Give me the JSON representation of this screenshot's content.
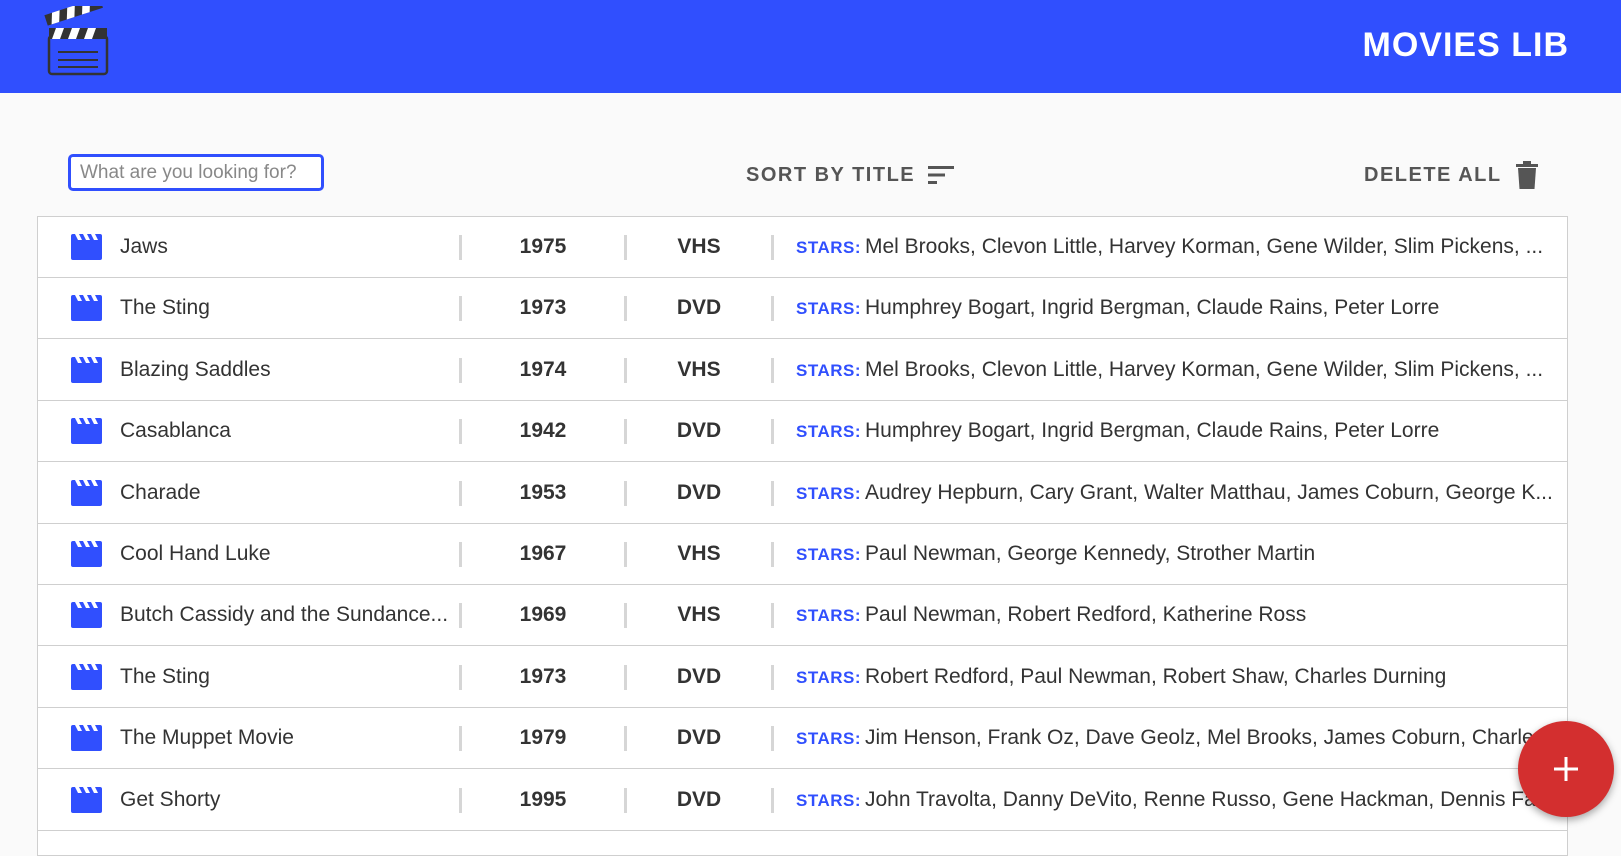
{
  "header": {
    "title": "MOVIES LIB",
    "logo_icon": "clapperboard-icon"
  },
  "toolbar": {
    "search_placeholder": "What are you looking for?",
    "search_value": "",
    "sort_label": "SORT BY TITLE",
    "sort_icon": "sort-icon",
    "delete_label": "DELETE ALL",
    "delete_icon": "trash-icon"
  },
  "stars_label": "STARS:",
  "movies": [
    {
      "title": "Jaws",
      "year": "1975",
      "format": "VHS",
      "stars": "Mel Brooks, Clevon Little, Harvey Korman, Gene Wilder, Slim Pickens, ..."
    },
    {
      "title": "The Sting",
      "year": "1973",
      "format": "DVD",
      "stars": "Humphrey Bogart, Ingrid Bergman, Claude Rains, Peter Lorre"
    },
    {
      "title": "Blazing Saddles",
      "year": "1974",
      "format": "VHS",
      "stars": "Mel Brooks, Clevon Little, Harvey Korman, Gene Wilder, Slim Pickens, ..."
    },
    {
      "title": "Casablanca",
      "year": "1942",
      "format": "DVD",
      "stars": "Humphrey Bogart, Ingrid Bergman, Claude Rains, Peter Lorre"
    },
    {
      "title": "Charade",
      "year": "1953",
      "format": "DVD",
      "stars": "Audrey Hepburn, Cary Grant, Walter Matthau, James Coburn, George K..."
    },
    {
      "title": "Cool Hand Luke",
      "year": "1967",
      "format": "VHS",
      "stars": "Paul Newman, George Kennedy, Strother Martin"
    },
    {
      "title": "Butch Cassidy and the Sundance...",
      "year": "1969",
      "format": "VHS",
      "stars": "Paul Newman, Robert Redford, Katherine Ross"
    },
    {
      "title": "The Sting",
      "year": "1973",
      "format": "DVD",
      "stars": "Robert Redford, Paul Newman, Robert Shaw, Charles Durning"
    },
    {
      "title": "The Muppet Movie",
      "year": "1979",
      "format": "DVD",
      "stars": "Jim Henson, Frank Oz, Dave Geolz, Mel Brooks, James Coburn, Charles"
    },
    {
      "title": "Get Shorty",
      "year": "1995",
      "format": "DVD",
      "stars": "John Travolta, Danny DeVito, Renne Russo, Gene Hackman, Dennis Fari..."
    }
  ],
  "fab": {
    "label": "+",
    "icon": "add-icon"
  },
  "colors": {
    "primary": "#304ffe",
    "accent": "#d32f2f",
    "background": "#fafafa"
  }
}
